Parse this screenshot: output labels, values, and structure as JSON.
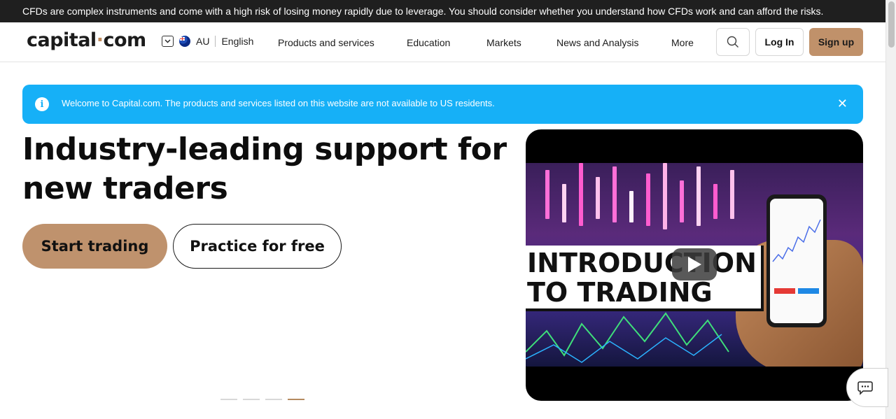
{
  "risk_warning": "CFDs are complex instruments and come with a high risk of losing money rapidly due to leverage. You should consider whether you understand how CFDs work and can afford the risks.",
  "header": {
    "logo_main": "capital",
    "logo_dot": "·",
    "logo_tail": "com",
    "region": "AU",
    "language": "English",
    "nav": [
      "Products and services",
      "Education",
      "Markets",
      "News and Analysis",
      "More"
    ],
    "login": "Log In",
    "signup": "Sign up"
  },
  "banner": {
    "info_glyph": "i",
    "text": "Welcome to Capital.com. The products and services listed on this website are not available to US residents.",
    "close": "✕"
  },
  "hero": {
    "title": "Industry-leading support for new traders",
    "primary_cta": "Start trading",
    "secondary_cta": "Practice for free"
  },
  "video": {
    "overlay_line1": "INTRODUCTION",
    "overlay_line2": "TO TRADING"
  },
  "carousel": {
    "slides": 4,
    "active_index": 3
  },
  "colors": {
    "accent": "#c0916a",
    "banner": "#16b0f7",
    "risk_bar": "#1f1f1f"
  }
}
